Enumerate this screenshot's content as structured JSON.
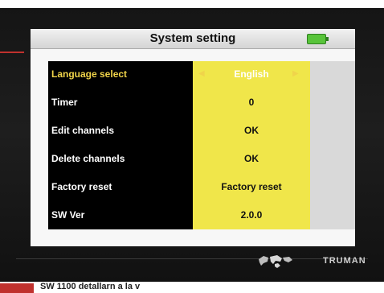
{
  "header": {
    "title": "System setting",
    "battery_icon": "battery-icon"
  },
  "menu": {
    "rows": [
      {
        "label": "Language select",
        "value": "English",
        "selected": true
      },
      {
        "label": "Timer",
        "value": "0"
      },
      {
        "label": "Edit channels",
        "value": "OK"
      },
      {
        "label": "Delete channels",
        "value": "OK"
      },
      {
        "label": "Factory reset",
        "value": "Factory reset"
      },
      {
        "label": "SW Ver",
        "value": "2.0.0"
      }
    ]
  },
  "footer": {
    "brand": "TRUMAN",
    "world_icon": "world-map-icon"
  },
  "caption": {
    "text": "SW 1100 detallarn a la v"
  },
  "colors": {
    "selected_label": "#f0d44a",
    "value_column": "#f0e64a",
    "accent": "#c0312e",
    "battery": "#58c43a"
  }
}
